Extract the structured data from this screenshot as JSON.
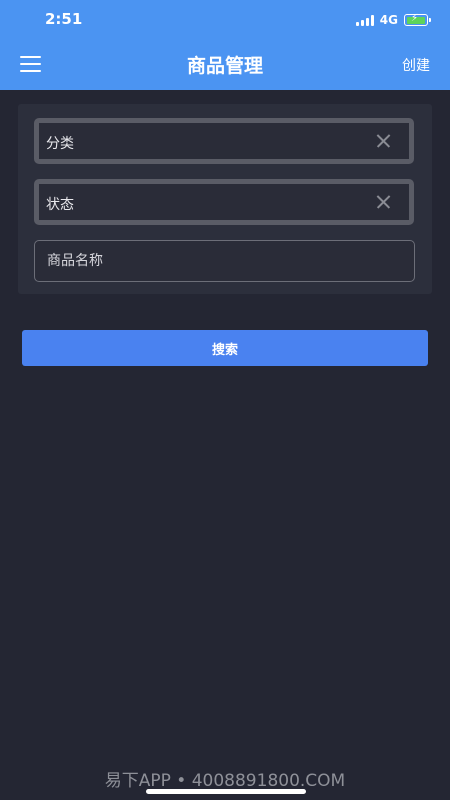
{
  "status_bar": {
    "time": "2:51",
    "network": "4G",
    "signal_icon": "cellular-signal-icon",
    "battery_icon": "battery-charging-icon",
    "battery_color": "#5ed45a"
  },
  "header": {
    "title": "商品管理",
    "create_label": "创建",
    "menu_icon": "hamburger-menu-icon",
    "background_color": "#4b94f2"
  },
  "filters": {
    "category_label": "分类",
    "status_label": "状态",
    "clear_icon": "close-icon",
    "name_input": {
      "placeholder": "商品名称",
      "value": ""
    }
  },
  "search_button": {
    "label": "搜索",
    "color": "#4a82f0"
  },
  "watermark": "易下APP • 4008891800.COM"
}
